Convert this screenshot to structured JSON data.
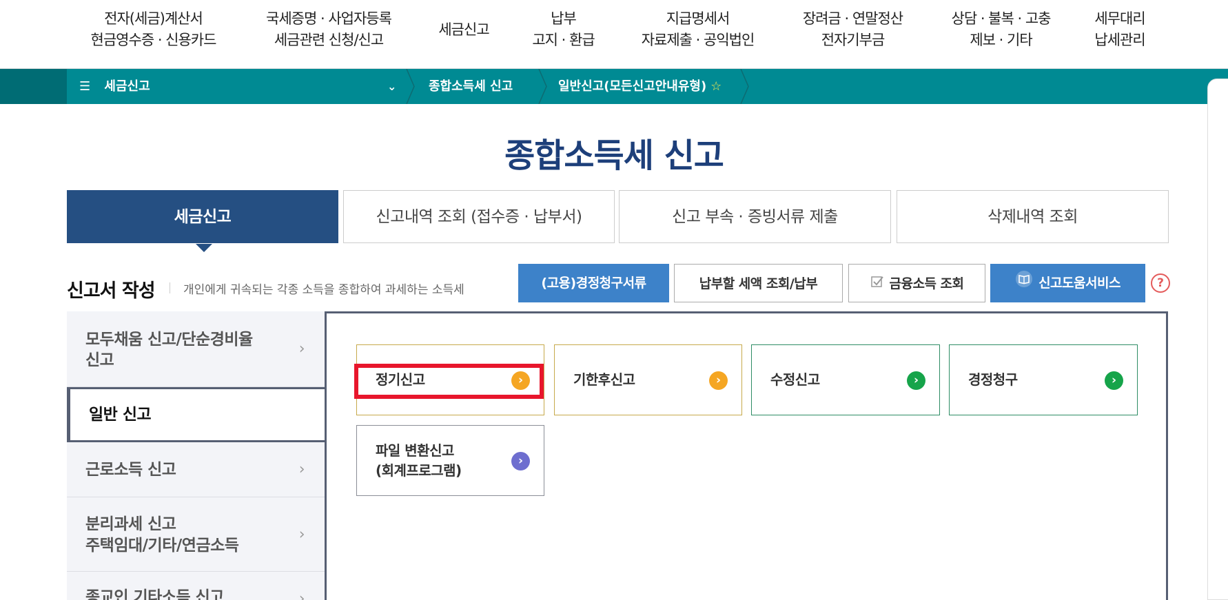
{
  "top_nav": [
    {
      "line1": "전자(세금)계산서",
      "line2": "현금영수증 · 신용카드"
    },
    {
      "line1": "국세증명 · 사업자등록",
      "line2": "세금관련 신청/신고"
    },
    {
      "line1": "세금신고",
      "line2": ""
    },
    {
      "line1": "납부",
      "line2": "고지 · 환급"
    },
    {
      "line1": "지급명세서",
      "line2": "자료제출 · 공익법인"
    },
    {
      "line1": "장려금 · 연말정산",
      "line2": "전자기부금"
    },
    {
      "line1": "상담 · 불복 · 고충",
      "line2": "제보 · 기타"
    },
    {
      "line1": "세무대리",
      "line2": "납세관리"
    }
  ],
  "breadcrumb": {
    "menu_label": "세금신고",
    "hamburger_glyph": "☰",
    "chevron_glyph": "⌄",
    "crumb1": "종합소득세 신고",
    "crumb2": "일반신고(모든신고안내유형)",
    "star_glyph": "☆"
  },
  "page_title": "종합소득세  신고",
  "tabs": [
    {
      "label": "세금신고",
      "active": true
    },
    {
      "label": "신고내역 조회 (접수증 · 납부서)",
      "active": false
    },
    {
      "label": "신고 부속 · 증빙서류 제출",
      "active": false
    },
    {
      "label": "삭제내역 조회",
      "active": false
    }
  ],
  "section": {
    "title": "신고서 작성",
    "description": "개인에게 귀속되는 각종 소득을 종합하여 과세하는 소득세"
  },
  "actions": {
    "correction_docs": "(고용)경정청구서류",
    "tax_payment": "납부할 세액 조회/납부",
    "financial_income": "금융소득 조회",
    "help_service": "신고도움서비스",
    "help_glyph": "?"
  },
  "side_menu": [
    {
      "label": "모두채움 신고/단순경비율\n신고",
      "active": false
    },
    {
      "label": "일반 신고",
      "active": true
    },
    {
      "label": "근로소득 신고",
      "active": false
    },
    {
      "label": "분리과세 신고\n주택임대/기타/연금소득",
      "active": false
    },
    {
      "label": "종교인 기타소득 신고",
      "active": false
    }
  ],
  "cards": [
    {
      "label": "정기신고",
      "color": "orange"
    },
    {
      "label": "기한후신고",
      "color": "orange"
    },
    {
      "label": "수정신고",
      "color": "green"
    },
    {
      "label": "경정청구",
      "color": "green"
    },
    {
      "label": "파일 변환신고\n(회계프로그램)",
      "color": "purple"
    }
  ],
  "chevron_glyph": "›",
  "go_glyph": "›",
  "colors": {
    "brand_teal": "#008a93",
    "title_navy": "#1d3f7a",
    "active_tab": "#254f82",
    "action_blue": "#3d82c9",
    "highlight_red": "#e8162c"
  }
}
